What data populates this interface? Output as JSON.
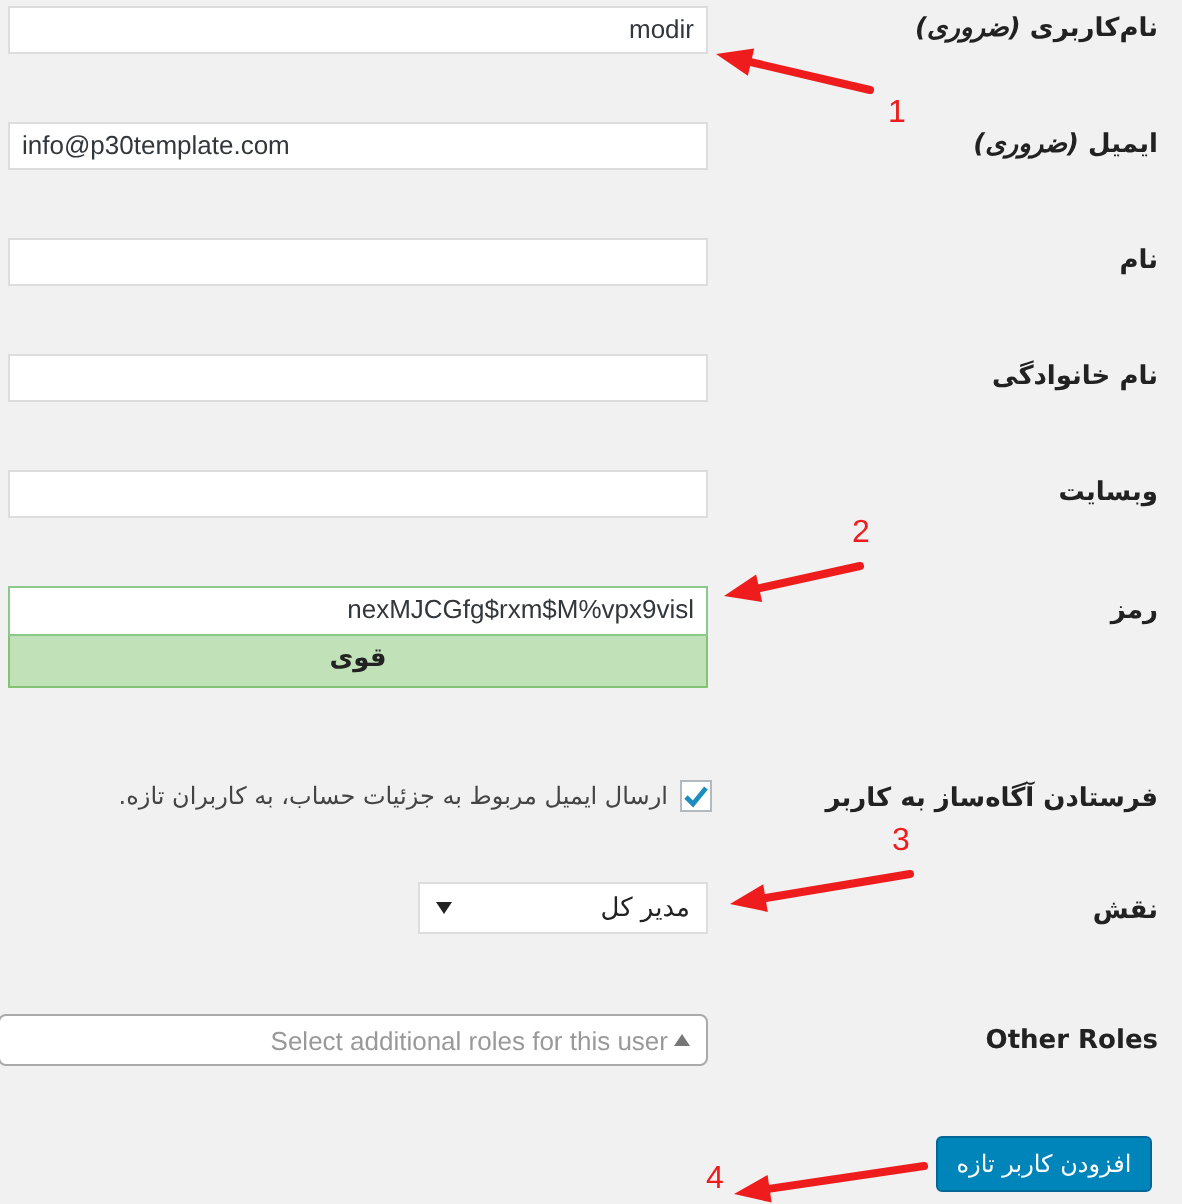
{
  "form": {
    "fields": [
      {
        "kind": "text",
        "label": "نام‌کاربری *(ضروری)*",
        "value": "modir"
      },
      {
        "kind": "email",
        "label": "ایمیل *(ضروری)*",
        "value": "info@p30template.com"
      },
      {
        "kind": "text",
        "label": "نام"
      },
      {
        "kind": "text",
        "label": "نام خانوادگی"
      },
      {
        "kind": "text",
        "label": "وبسایت"
      },
      {
        "kind": "password",
        "label": "رمز",
        "value": "nexMJCGfg$rxm$M%vpx9visl",
        "strength": "قوی"
      },
      {
        "kind": "checkbox",
        "label": "فرستادن آگاه‌ساز به کاربر",
        "text": "ارسال ایمیل مربوط به جزئیات حساب، به کاربران تازه.",
        "checked": true
      },
      {
        "kind": "select",
        "label": "نقش",
        "value": "مدیر کل"
      },
      {
        "kind": "multiselect",
        "label": "Other Roles",
        "placeholder": "Select additional roles for this user"
      }
    ],
    "submit_button": "افزودن کاربر تازه"
  },
  "annotations": [
    {
      "label": "1"
    },
    {
      "label": "2"
    },
    {
      "label": "3"
    },
    {
      "label": "4"
    }
  ]
}
